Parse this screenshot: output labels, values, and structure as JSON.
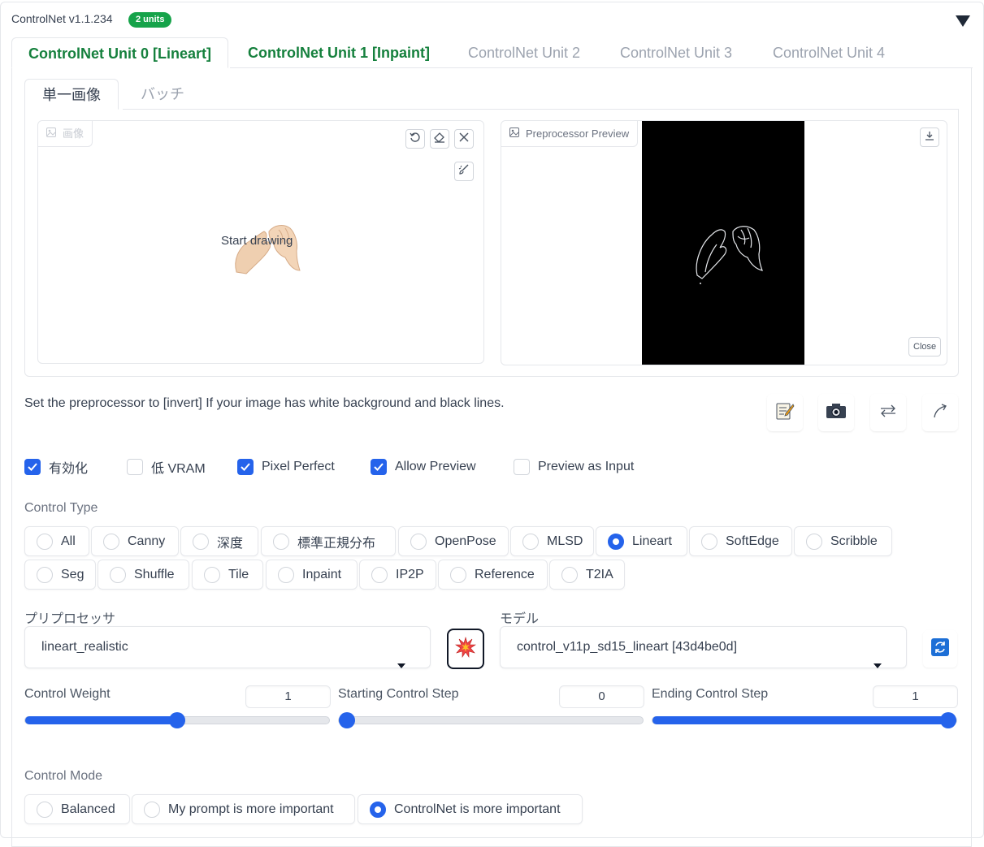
{
  "header": {
    "title": "ControlNet v1.1.234",
    "badge": "2 units"
  },
  "unit_tabs": [
    "ControlNet Unit 0 [Lineart]",
    "ControlNet Unit 1 [Inpaint]",
    "ControlNet Unit 2",
    "ControlNet Unit 3",
    "ControlNet Unit 4"
  ],
  "image_tabs": [
    "単一画像",
    "バッチ"
  ],
  "image_input": {
    "label": "画像",
    "placeholder": "Start drawing"
  },
  "preview": {
    "label": "Preprocessor Preview",
    "close_label": "Close"
  },
  "hint_text": "Set the preprocessor to [invert] If your image has white background and black lines.",
  "options": [
    {
      "label": "有効化",
      "checked": true
    },
    {
      "label": "低 VRAM",
      "checked": false
    },
    {
      "label": "Pixel Perfect",
      "checked": true
    },
    {
      "label": "Allow Preview",
      "checked": true
    },
    {
      "label": "Preview as Input",
      "checked": false
    }
  ],
  "control_type": {
    "label": "Control Type",
    "row1": [
      "All",
      "Canny",
      "深度",
      "標準正規分布",
      "OpenPose",
      "MLSD",
      "Lineart",
      "SoftEdge",
      "Scribble"
    ],
    "row2": [
      "Seg",
      "Shuffle",
      "Tile",
      "Inpaint",
      "IP2P",
      "Reference",
      "T2IA"
    ],
    "selected": "Lineart"
  },
  "preprocessor": {
    "label": "プリプロセッサ",
    "value": "lineart_realistic"
  },
  "model": {
    "label": "モデル",
    "value": "control_v11p_sd15_lineart [43d4be0d]"
  },
  "sliders": [
    {
      "label": "Control Weight",
      "value": "1",
      "fraction": 0.5
    },
    {
      "label": "Starting Control Step",
      "value": "0",
      "fraction": 0.0
    },
    {
      "label": "Ending Control Step",
      "value": "1",
      "fraction": 1.0
    }
  ],
  "control_mode": {
    "label": "Control Mode",
    "options": [
      "Balanced",
      "My prompt is more important",
      "ControlNet is more important"
    ],
    "selected": "ControlNet is more important"
  },
  "colors": {
    "accent": "#2563eb",
    "green": "#15803d",
    "badge": "#16a34a"
  }
}
